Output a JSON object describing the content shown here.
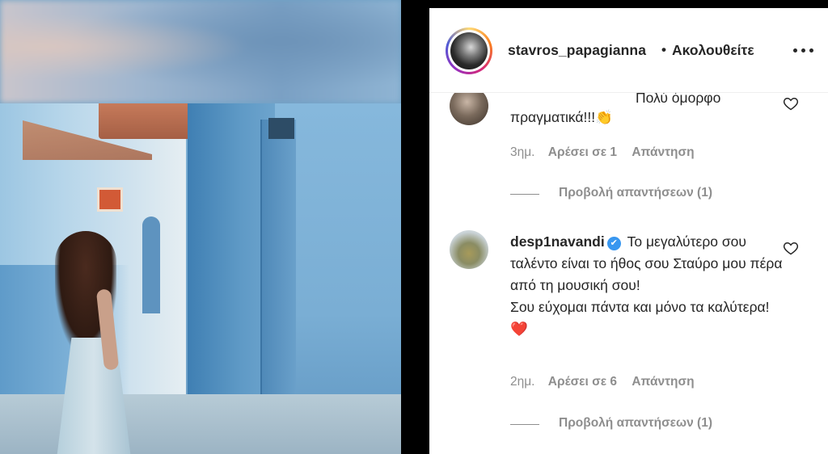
{
  "post_media": {
    "description": ""
  },
  "header": {
    "username": "stavros_papagianna",
    "separator": "•",
    "follow_status": "Ακολουθείτε",
    "more_icon": "more-horizontal-icon"
  },
  "comments": [
    {
      "text_line1": "Πολύ όμορφο",
      "text_line2": "πραγματικά!!!",
      "emoji": "👏",
      "time": "3ημ.",
      "likes": "Αρέσει σε 1",
      "reply": "Απάντηση",
      "view_replies": "Προβολή απαντήσεων (1)"
    },
    {
      "username": "desp1navandi",
      "verified_icon": "✔",
      "text": "Το μεγαλύτερο σου ταλέντο είναι το ήθος σου Σταύρο μου πέρα από τη μουσική σου!",
      "text2": "Σου εύχομαι πάντα και μόνο τα καλύτερα!",
      "emoji": "❤️",
      "time": "2ημ.",
      "likes": "Αρέσει σε 6",
      "reply": "Απάντηση",
      "view_replies": "Προβολή απαντήσεων (1)"
    }
  ]
}
